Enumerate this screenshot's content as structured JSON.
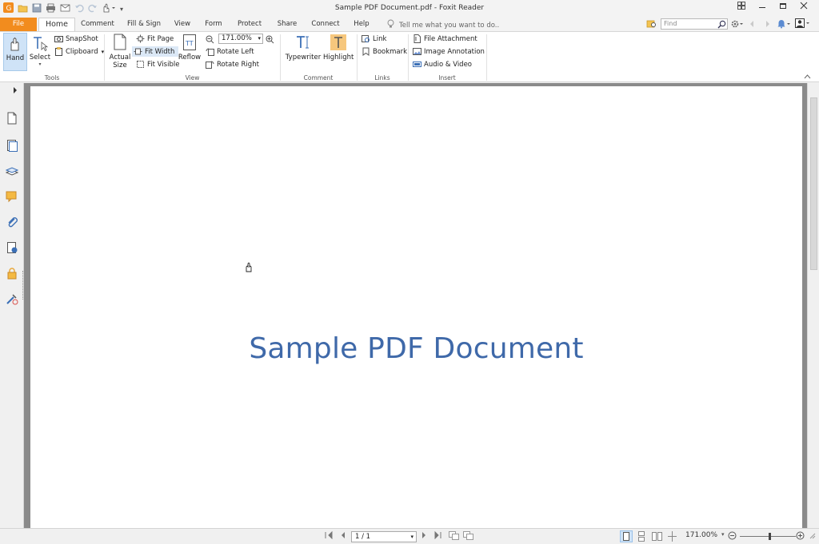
{
  "window": {
    "title": "Sample PDF Document.pdf - Foxit Reader"
  },
  "tabs": [
    {
      "label": "File"
    },
    {
      "label": "Home"
    },
    {
      "label": "Comment"
    },
    {
      "label": "Fill & Sign"
    },
    {
      "label": "View"
    },
    {
      "label": "Form"
    },
    {
      "label": "Protect"
    },
    {
      "label": "Share"
    },
    {
      "label": "Connect"
    },
    {
      "label": "Help"
    }
  ],
  "tellme": {
    "placeholder": "Tell me what you want to do.."
  },
  "find": {
    "placeholder": "Find"
  },
  "ribbon": {
    "tools": {
      "hand": "Hand",
      "select": "Select",
      "snapshot": "SnapShot",
      "clipboard": "Clipboard",
      "group": "Tools"
    },
    "view": {
      "actual_size_1": "Actual",
      "actual_size_2": "Size",
      "fit_page": "Fit Page",
      "fit_width": "Fit Width",
      "fit_visible": "Fit Visible",
      "reflow": "Reflow",
      "zoom": "171.00%",
      "rotate_left": "Rotate Left",
      "rotate_right": "Rotate Right",
      "group": "View"
    },
    "comment": {
      "typewriter": "Typewriter",
      "highlight": "Highlight",
      "group": "Comment"
    },
    "links": {
      "link": "Link",
      "bookmark": "Bookmark",
      "group": "Links"
    },
    "insert": {
      "file_attachment": "File Attachment",
      "image_annotation": "Image Annotation",
      "audio_video": "Audio & Video",
      "group": "Insert"
    }
  },
  "document": {
    "heading": "Sample PDF Document"
  },
  "status": {
    "page": "1 / 1",
    "zoom": "171.00%"
  },
  "colors": {
    "file_tab": "#f28c1e",
    "heading": "#3f69a9",
    "doc_background": "#8a8a8a"
  }
}
